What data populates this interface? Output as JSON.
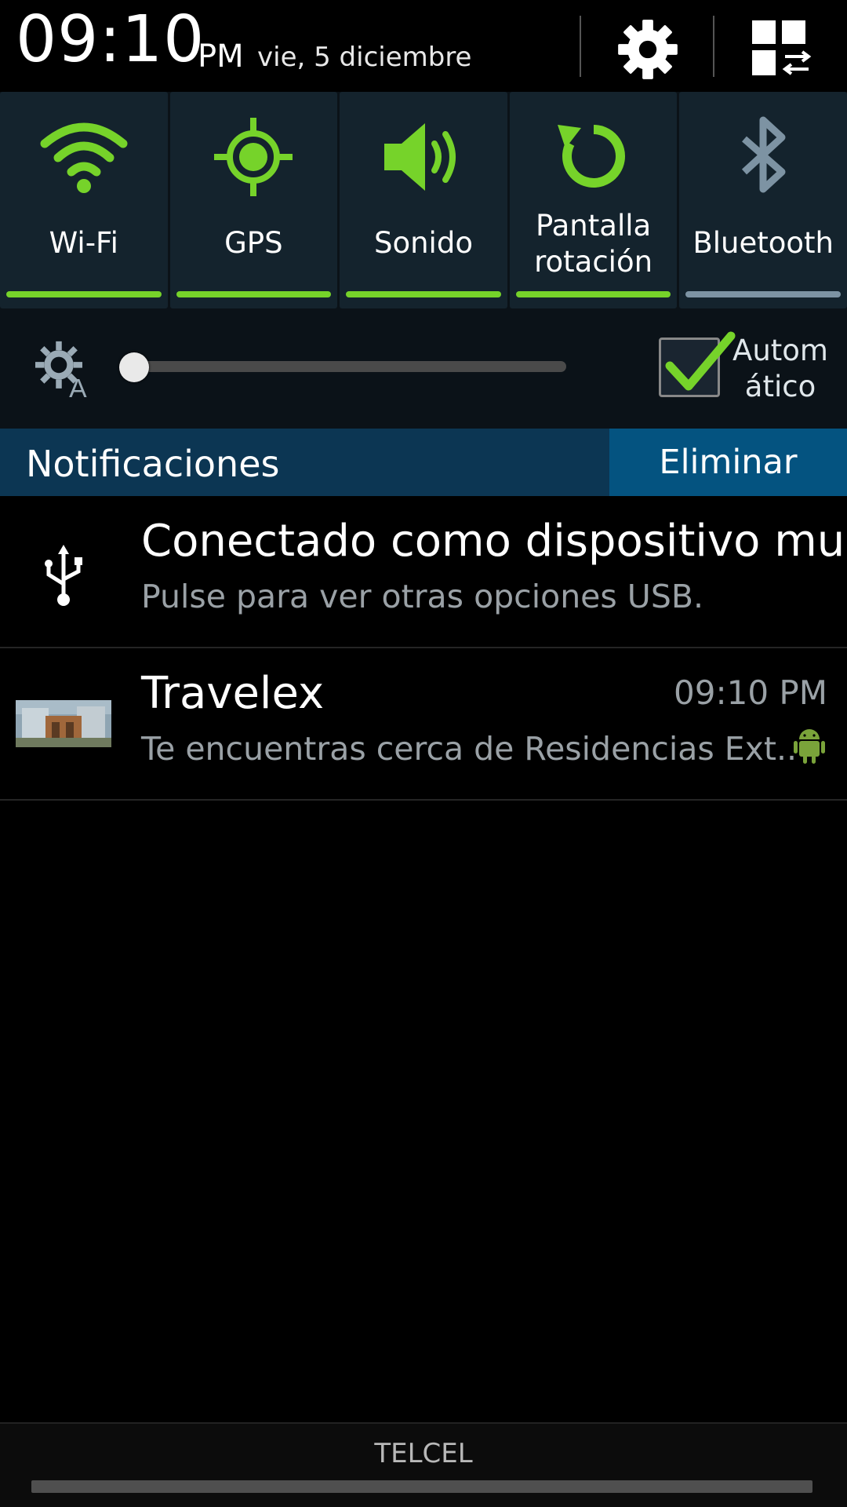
{
  "header": {
    "time": "09:10",
    "ampm": "PM",
    "date": "vie, 5 diciembre",
    "settings_icon": "gear-icon",
    "multiwindow_icon": "multi-window-icon"
  },
  "toggles": [
    {
      "label": "Wi-Fi",
      "icon": "wifi-icon",
      "on": true
    },
    {
      "label": "GPS",
      "icon": "gps-icon",
      "on": true
    },
    {
      "label": "Sonido",
      "icon": "sound-icon",
      "on": true
    },
    {
      "label_line1": "Pantalla",
      "label_line2": "rotación",
      "icon": "rotate-icon",
      "on": true
    },
    {
      "label": "Bluetooth",
      "icon": "bluetooth-icon",
      "on": false
    }
  ],
  "brightness": {
    "level": 0.0,
    "auto_label_line1": "Autom",
    "auto_label_line2": "ático",
    "auto_checked": true
  },
  "notifications_header": {
    "title": "Notificaciones",
    "clear_label": "Eliminar"
  },
  "notifications": [
    {
      "icon": "usb-icon",
      "title": "Conectado como dispositivo mu..",
      "text": "Pulse para ver otras opciones USB."
    },
    {
      "icon": "building-thumbnail",
      "title": "Travelex",
      "time": "09:10 PM",
      "text": "Te encuentras cerca de Residencias Ext..",
      "badge_icon": "android-icon"
    }
  ],
  "carrier": "TELCEL",
  "colors": {
    "accent_green": "#76d32a",
    "toggle_bg": "#14232d",
    "notif_header_bg": "#0c3653",
    "clear_bg": "#045380"
  }
}
